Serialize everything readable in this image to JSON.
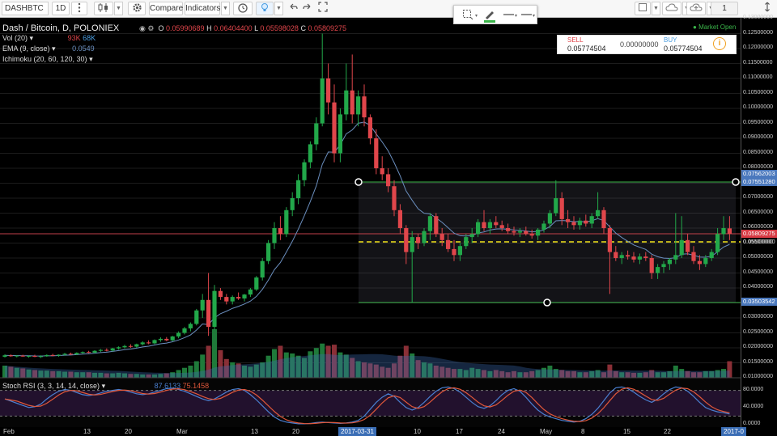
{
  "toolbar": {
    "symbol": "DASHBTC",
    "interval": "1D",
    "compare_label": "Compare",
    "indicators_label": "Indicators",
    "layout_count": "1"
  },
  "legend": {
    "title": "Dash / Bitcoin, D, POLONIEX",
    "ohlc": {
      "o_label": "O",
      "o": "0.05990689",
      "h_label": "H",
      "h": "0.06404400",
      "l_label": "L",
      "l": "0.05598028",
      "c_label": "C",
      "c": "0.05809275"
    },
    "vol_label": "Vol (20)",
    "vol_value_1": "93K",
    "vol_value_2": "68K",
    "ema_label": "EMA (9, close)",
    "ema_value": "0.0549",
    "ichimoku_label": "Ichimoku (20, 60, 120, 30)",
    "stoch_label": "Stoch RSI (3, 3, 14, 14, close)",
    "stoch_value_1": "87.6133",
    "stoch_value_2": "75.1458"
  },
  "market_status": "Market Open",
  "trade": {
    "sell_label": "SELL",
    "sell_price": "0.05774504",
    "spread": "0.00000000",
    "buy_label": "BUY",
    "buy_price": "0.05774504"
  },
  "price_axis": {
    "ticks": [
      "0.13000000",
      "0.12500000",
      "0.12000000",
      "0.11500000",
      "0.11000000",
      "0.10500000",
      "0.10000000",
      "0.09500000",
      "0.09000000",
      "0.08500000",
      "0.08000000",
      "0.07500000",
      "0.07000000",
      "0.06500000",
      "0.06000000",
      "0.05500000",
      "0.05000000",
      "0.04500000",
      "0.04000000",
      "0.03500000",
      "0.03000000",
      "0.02500000",
      "0.02000000",
      "0.01500000",
      "0.01000000"
    ],
    "labels": {
      "range_top_1": "0.07562003",
      "range_top_2": "0.07551280",
      "last_price": "0.05809275",
      "mid": "0.05500000",
      "range_bottom": "0.03503542"
    }
  },
  "stoch_axis": {
    "ticks": [
      "80.0000",
      "40.0000",
      "0.0000"
    ]
  },
  "time_axis": {
    "ticks": [
      "Feb",
      "13",
      "20",
      "Mar",
      "13",
      "20",
      "10",
      "17",
      "24",
      "May",
      "8",
      "15",
      "22"
    ],
    "highlight_1": "2017-03-31",
    "highlight_2": "2017-0"
  },
  "colors": {
    "up": "#22a84a",
    "down": "#e0464b",
    "ema": "#6b8fbf",
    "range_line": "#3bb54a",
    "mid_line": "#f2e31a",
    "price_line": "#c0404a",
    "stoch_k": "#4a7fd0",
    "stoch_d": "#e0573a"
  },
  "chart_data": {
    "type": "candlestick",
    "y_range": [
      0.01,
      0.13
    ],
    "candles": [
      [
        0.017,
        0.0178,
        0.0168,
        0.0175
      ],
      [
        0.0175,
        0.0178,
        0.017,
        0.0172
      ],
      [
        0.0172,
        0.0176,
        0.0168,
        0.0174
      ],
      [
        0.0174,
        0.0177,
        0.017,
        0.0171
      ],
      [
        0.0171,
        0.0175,
        0.0167,
        0.0173
      ],
      [
        0.0173,
        0.0177,
        0.0169,
        0.017
      ],
      [
        0.017,
        0.0175,
        0.0166,
        0.0172
      ],
      [
        0.0172,
        0.0178,
        0.017,
        0.0176
      ],
      [
        0.0176,
        0.018,
        0.0172,
        0.0174
      ],
      [
        0.0174,
        0.0178,
        0.017,
        0.0177
      ],
      [
        0.0177,
        0.0183,
        0.0174,
        0.018
      ],
      [
        0.018,
        0.0184,
        0.0176,
        0.0178
      ],
      [
        0.0178,
        0.0185,
        0.0176,
        0.0183
      ],
      [
        0.0183,
        0.0188,
        0.018,
        0.0186
      ],
      [
        0.0186,
        0.019,
        0.0182,
        0.0184
      ],
      [
        0.0184,
        0.0192,
        0.0182,
        0.019
      ],
      [
        0.019,
        0.0196,
        0.0186,
        0.0193
      ],
      [
        0.0193,
        0.0198,
        0.0188,
        0.0191
      ],
      [
        0.0191,
        0.02,
        0.0188,
        0.0198
      ],
      [
        0.0198,
        0.0205,
        0.0194,
        0.0202
      ],
      [
        0.0202,
        0.021,
        0.0198,
        0.0206
      ],
      [
        0.0206,
        0.0212,
        0.02,
        0.0204
      ],
      [
        0.0204,
        0.0214,
        0.02,
        0.0212
      ],
      [
        0.0212,
        0.0222,
        0.0208,
        0.0218
      ],
      [
        0.0218,
        0.0225,
        0.0212,
        0.0215
      ],
      [
        0.0215,
        0.0228,
        0.0212,
        0.0226
      ],
      [
        0.0226,
        0.0235,
        0.022,
        0.023
      ],
      [
        0.023,
        0.0236,
        0.0222,
        0.0225
      ],
      [
        0.0225,
        0.024,
        0.0222,
        0.0238
      ],
      [
        0.0238,
        0.0255,
        0.0232,
        0.025
      ],
      [
        0.025,
        0.027,
        0.0245,
        0.0265
      ],
      [
        0.0265,
        0.0285,
        0.0255,
        0.028
      ],
      [
        0.028,
        0.033,
        0.0275,
        0.0325
      ],
      [
        0.0325,
        0.038,
        0.03,
        0.036
      ],
      [
        0.036,
        0.045,
        0.024,
        0.027
      ],
      [
        0.027,
        0.041,
        0.026,
        0.039
      ],
      [
        0.039,
        0.04,
        0.036,
        0.037
      ],
      [
        0.037,
        0.038,
        0.0345,
        0.0355
      ],
      [
        0.0355,
        0.0375,
        0.0345,
        0.037
      ],
      [
        0.037,
        0.0385,
        0.036,
        0.0365
      ],
      [
        0.0365,
        0.038,
        0.0355,
        0.0378
      ],
      [
        0.0378,
        0.04,
        0.037,
        0.0395
      ],
      [
        0.0395,
        0.044,
        0.039,
        0.0435
      ],
      [
        0.0435,
        0.05,
        0.0425,
        0.049
      ],
      [
        0.049,
        0.056,
        0.048,
        0.055
      ],
      [
        0.055,
        0.062,
        0.053,
        0.06
      ],
      [
        0.06,
        0.064,
        0.056,
        0.058
      ],
      [
        0.058,
        0.067,
        0.057,
        0.066
      ],
      [
        0.066,
        0.072,
        0.064,
        0.07
      ],
      [
        0.07,
        0.078,
        0.068,
        0.076
      ],
      [
        0.076,
        0.083,
        0.074,
        0.082
      ],
      [
        0.082,
        0.089,
        0.08,
        0.088
      ],
      [
        0.088,
        0.097,
        0.086,
        0.095
      ],
      [
        0.095,
        0.125,
        0.094,
        0.11
      ],
      [
        0.11,
        0.115,
        0.098,
        0.102
      ],
      [
        0.102,
        0.108,
        0.082,
        0.085
      ],
      [
        0.085,
        0.1,
        0.082,
        0.098
      ],
      [
        0.098,
        0.115,
        0.096,
        0.106
      ],
      [
        0.106,
        0.118,
        0.095,
        0.098
      ],
      [
        0.098,
        0.106,
        0.094,
        0.104
      ],
      [
        0.104,
        0.108,
        0.094,
        0.097
      ],
      [
        0.097,
        0.098,
        0.088,
        0.09
      ],
      [
        0.09,
        0.093,
        0.078,
        0.08
      ],
      [
        0.08,
        0.084,
        0.076,
        0.078
      ],
      [
        0.078,
        0.08,
        0.072,
        0.074
      ],
      [
        0.074,
        0.076,
        0.064,
        0.066
      ],
      [
        0.066,
        0.068,
        0.058,
        0.06
      ],
      [
        0.06,
        0.061,
        0.048,
        0.052
      ],
      [
        0.052,
        0.059,
        0.035,
        0.057
      ],
      [
        0.057,
        0.058,
        0.053,
        0.055
      ],
      [
        0.055,
        0.06,
        0.054,
        0.059
      ],
      [
        0.059,
        0.065,
        0.056,
        0.064
      ],
      [
        0.064,
        0.065,
        0.057,
        0.058
      ],
      [
        0.058,
        0.06,
        0.054,
        0.056
      ],
      [
        0.056,
        0.058,
        0.052,
        0.053
      ],
      [
        0.053,
        0.056,
        0.049,
        0.051
      ],
      [
        0.051,
        0.055,
        0.049,
        0.054
      ],
      [
        0.054,
        0.058,
        0.053,
        0.057
      ],
      [
        0.057,
        0.06,
        0.055,
        0.058
      ],
      [
        0.058,
        0.063,
        0.057,
        0.062
      ],
      [
        0.062,
        0.066,
        0.059,
        0.06
      ],
      [
        0.06,
        0.063,
        0.058,
        0.062
      ],
      [
        0.062,
        0.064,
        0.06,
        0.061
      ],
      [
        0.061,
        0.0625,
        0.059,
        0.06
      ],
      [
        0.06,
        0.0615,
        0.058,
        0.059
      ],
      [
        0.059,
        0.0605,
        0.0575,
        0.0585
      ],
      [
        0.0585,
        0.06,
        0.057,
        0.059
      ],
      [
        0.059,
        0.0605,
        0.0575,
        0.058
      ],
      [
        0.058,
        0.0595,
        0.0565,
        0.0575
      ],
      [
        0.0575,
        0.06,
        0.056,
        0.0595
      ],
      [
        0.0595,
        0.0625,
        0.0585,
        0.0615
      ],
      [
        0.0615,
        0.066,
        0.06,
        0.065
      ],
      [
        0.065,
        0.076,
        0.064,
        0.07
      ],
      [
        0.07,
        0.072,
        0.061,
        0.063
      ],
      [
        0.063,
        0.066,
        0.06,
        0.062
      ],
      [
        0.062,
        0.064,
        0.0595,
        0.061
      ],
      [
        0.061,
        0.0635,
        0.0595,
        0.0625
      ],
      [
        0.0625,
        0.0645,
        0.0605,
        0.0615
      ],
      [
        0.0615,
        0.065,
        0.06,
        0.064
      ],
      [
        0.064,
        0.072,
        0.063,
        0.066
      ],
      [
        0.066,
        0.067,
        0.058,
        0.06
      ],
      [
        0.06,
        0.061,
        0.038,
        0.052
      ],
      [
        0.052,
        0.054,
        0.049,
        0.05
      ],
      [
        0.05,
        0.052,
        0.048,
        0.051
      ],
      [
        0.051,
        0.0525,
        0.0495,
        0.0505
      ],
      [
        0.0505,
        0.052,
        0.0485,
        0.0495
      ],
      [
        0.0495,
        0.0515,
        0.048,
        0.0505
      ],
      [
        0.0505,
        0.052,
        0.049,
        0.05
      ],
      [
        0.05,
        0.051,
        0.043,
        0.045
      ],
      [
        0.045,
        0.048,
        0.043,
        0.047
      ],
      [
        0.047,
        0.049,
        0.045,
        0.048
      ],
      [
        0.048,
        0.05,
        0.046,
        0.0495
      ],
      [
        0.0495,
        0.065,
        0.048,
        0.051
      ],
      [
        0.051,
        0.064,
        0.05,
        0.056
      ],
      [
        0.056,
        0.058,
        0.051,
        0.052
      ],
      [
        0.052,
        0.054,
        0.048,
        0.049
      ],
      [
        0.049,
        0.051,
        0.046,
        0.048
      ],
      [
        0.048,
        0.051,
        0.047,
        0.05
      ],
      [
        0.05,
        0.053,
        0.049,
        0.052
      ],
      [
        0.052,
        0.06,
        0.051,
        0.058
      ],
      [
        0.058,
        0.064,
        0.056,
        0.06
      ],
      [
        0.0599,
        0.064,
        0.056,
        0.0581
      ]
    ],
    "volumes": [
      22,
      20,
      18,
      17,
      15,
      14,
      13,
      13,
      12,
      12,
      11,
      11,
      10,
      10,
      10,
      9,
      9,
      8,
      8,
      9,
      8,
      7,
      7,
      6,
      6,
      6,
      7,
      8,
      10,
      14,
      18,
      22,
      30,
      42,
      58,
      88,
      50,
      34,
      28,
      26,
      22,
      20,
      24,
      28,
      40,
      52,
      58,
      46,
      44,
      40,
      36,
      48,
      54,
      62,
      58,
      60,
      46,
      42,
      36,
      30,
      28,
      26,
      24,
      20,
      18,
      26,
      40,
      58,
      44,
      32,
      28,
      26,
      22,
      20,
      18,
      16,
      16,
      14,
      18,
      16,
      14,
      12,
      14,
      12,
      10,
      12,
      10,
      10,
      12,
      14,
      18,
      22,
      16,
      14,
      12,
      12,
      10,
      10,
      12,
      14,
      10,
      24,
      12,
      10,
      10,
      9,
      9,
      10,
      14,
      10,
      10,
      12,
      22,
      16,
      12,
      10,
      10,
      12,
      12,
      14,
      16,
      30
    ],
    "stoch_k": [
      60,
      55,
      50,
      45,
      40,
      42,
      48,
      60,
      70,
      78,
      82,
      80,
      75,
      70,
      68,
      70,
      74,
      78,
      80,
      82,
      80,
      76,
      72,
      70,
      72,
      76,
      80,
      84,
      85,
      82,
      78,
      72,
      66,
      60,
      56,
      60,
      68,
      76,
      82,
      84,
      80,
      70,
      58,
      44,
      30,
      18,
      10,
      6,
      4,
      2,
      2,
      3,
      5,
      6,
      5,
      4,
      3,
      4,
      6,
      10,
      20,
      36,
      52,
      64,
      72,
      66,
      52,
      40,
      34,
      40,
      52,
      66,
      78,
      86,
      88,
      84,
      76,
      64,
      52,
      42,
      38,
      44,
      56,
      70,
      80,
      84,
      78,
      64,
      48,
      34,
      24,
      18,
      14,
      10,
      8,
      6,
      8,
      14,
      24,
      38,
      56,
      74,
      86,
      88,
      84,
      76,
      66,
      58,
      52,
      60,
      72,
      82,
      88,
      86,
      78,
      66,
      52,
      40,
      34,
      30,
      28,
      25
    ]
  }
}
